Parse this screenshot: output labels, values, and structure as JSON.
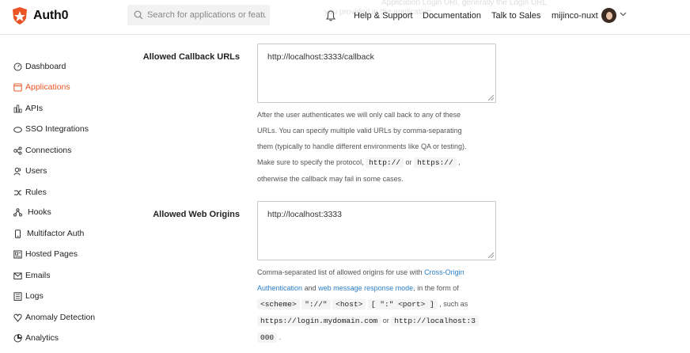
{
  "brand": {
    "name": "Auth0",
    "accent": "#eb5424"
  },
  "header": {
    "search_placeholder": "Search for applications or featu",
    "ghost_text_1": "Application Login URI, generally the Login URL",
    "ghost_text_2": "you provided in the application",
    "links": [
      "Help & Support",
      "Documentation",
      "Talk to Sales"
    ],
    "username": "mijinco-nuxt"
  },
  "sidebar": {
    "items": [
      {
        "label": "Dashboard",
        "icon": "dashboard-icon"
      },
      {
        "label": "Applications",
        "icon": "applications-icon",
        "active": true
      },
      {
        "label": "APIs",
        "icon": "apis-icon"
      },
      {
        "label": "SSO Integrations",
        "icon": "sso-icon"
      },
      {
        "label": "Connections",
        "icon": "connections-icon"
      },
      {
        "label": "Users",
        "icon": "users-icon"
      },
      {
        "label": "Rules",
        "icon": "rules-icon"
      },
      {
        "label": "Hooks",
        "icon": "hooks-icon"
      },
      {
        "label": "Multifactor Auth",
        "icon": "mfa-icon"
      },
      {
        "label": "Hosted Pages",
        "icon": "hosted-pages-icon"
      },
      {
        "label": "Emails",
        "icon": "emails-icon"
      },
      {
        "label": "Logs",
        "icon": "logs-icon"
      },
      {
        "label": "Anomaly Detection",
        "icon": "anomaly-icon"
      },
      {
        "label": "Analytics",
        "icon": "analytics-icon"
      }
    ]
  },
  "callback": {
    "label": "Allowed Callback URLs",
    "value": "http://localhost:3333/callback",
    "help_lines": [
      "After the user authenticates we will only call back to any of these",
      "URLs. You can specify multiple valid URLs by comma-separating",
      "them (typically to handle different environments like QA or testing).",
      "Make sure to specify the protocol,"
    ],
    "code_http": "http://",
    "or": "or",
    "code_https": "https://",
    "help_comma": ",",
    "help_last": "otherwise the callback may fail in some cases."
  },
  "origins": {
    "label": "Allowed Web Origins",
    "value": "http://localhost:3333",
    "help_1": "Comma-separated list of allowed origins for use with",
    "link_cors": "Cross-Origin",
    "link_cors_2": "Authentication",
    "and": "and",
    "link_wmr": "web message response mode",
    "help_2": ", in the form of",
    "code_scheme": "<scheme>",
    "code_sep": "\"://\"",
    "code_host": "<host>",
    "code_bracket": "[ \":\" <port> ]",
    "such_as": ", such as",
    "code_example_1": "https://login.mydomain.com",
    "or": "or",
    "code_example_2a": "http://localhost:3",
    "code_example_2b": "000",
    "help_end": "."
  }
}
